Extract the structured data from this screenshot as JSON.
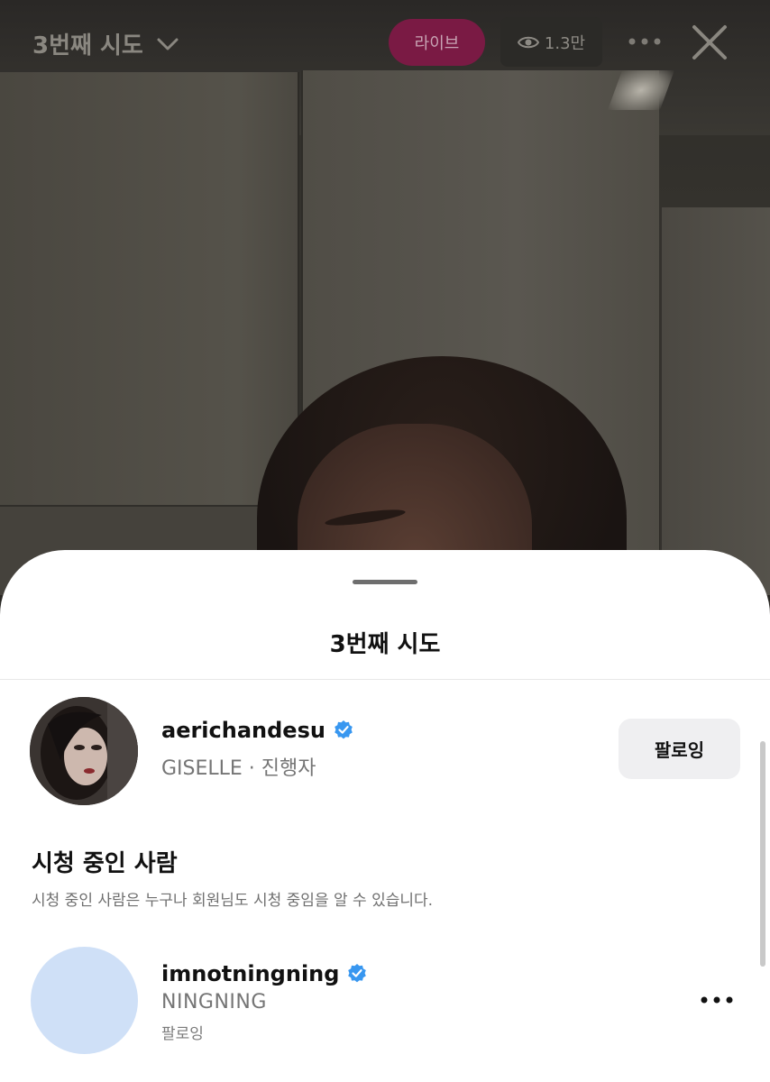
{
  "topbar": {
    "title": "3번째 시도",
    "live_label": "라이브",
    "viewer_count": "1.3만"
  },
  "sheet": {
    "title": "3번째 시도",
    "host": {
      "username": "aerichandesu",
      "subtitle": "GISELLE · 진행자",
      "follow_label": "팔로잉"
    },
    "viewers_heading": "시청 중인 사람",
    "viewers_description": "시청 중인 사람은 누구나 회원님도 시청 중임을 알 수 있습니다.",
    "viewers": [
      {
        "username": "imnotningning",
        "display_name": "NINGNING",
        "status": "팔로잉"
      }
    ]
  },
  "colors": {
    "live_button": "#7a1a44",
    "verified_badge": "#3897f0",
    "viewer_avatar_placeholder": "#cfe0f7"
  },
  "icons": [
    "chevron-down-icon",
    "eye-icon",
    "more-icon",
    "close-icon",
    "verified-badge-icon"
  ]
}
